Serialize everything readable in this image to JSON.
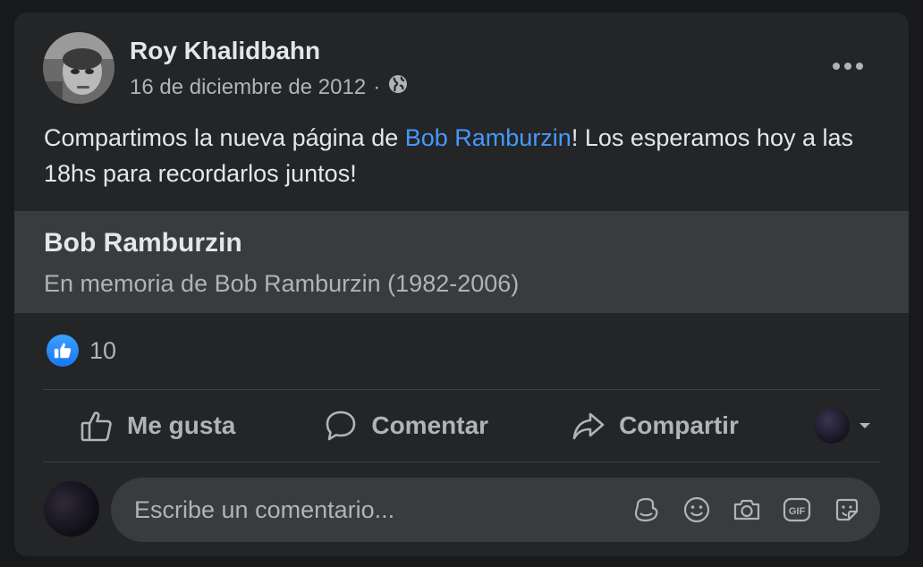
{
  "post": {
    "author": "Roy Khalidbahn",
    "date": "16 de diciembre de 2012",
    "separator": "·",
    "audience_icon": "globe-icon",
    "text_before": "Compartimos la nueva página de ",
    "mention": "Bob Ramburzin",
    "text_after": "! Los esperamos hoy a las 18hs para recordarlos juntos!"
  },
  "link_preview": {
    "title": "Bob Ramburzin",
    "description": "En memoria de Bob Ramburzin (1982-2006)"
  },
  "reactions": {
    "icon": "like-icon",
    "count": "10"
  },
  "actions": {
    "like": "Me gusta",
    "comment": "Comentar",
    "share": "Compartir"
  },
  "comment": {
    "placeholder": "Escribe un comentario..."
  },
  "colors": {
    "background": "#18191a",
    "card": "#242526",
    "secondary_surface": "#3a3b3c",
    "primary_text": "#e4e6eb",
    "secondary_text": "#b0b3b8",
    "link": "#4599ff",
    "like_blue": "#1877f2"
  }
}
